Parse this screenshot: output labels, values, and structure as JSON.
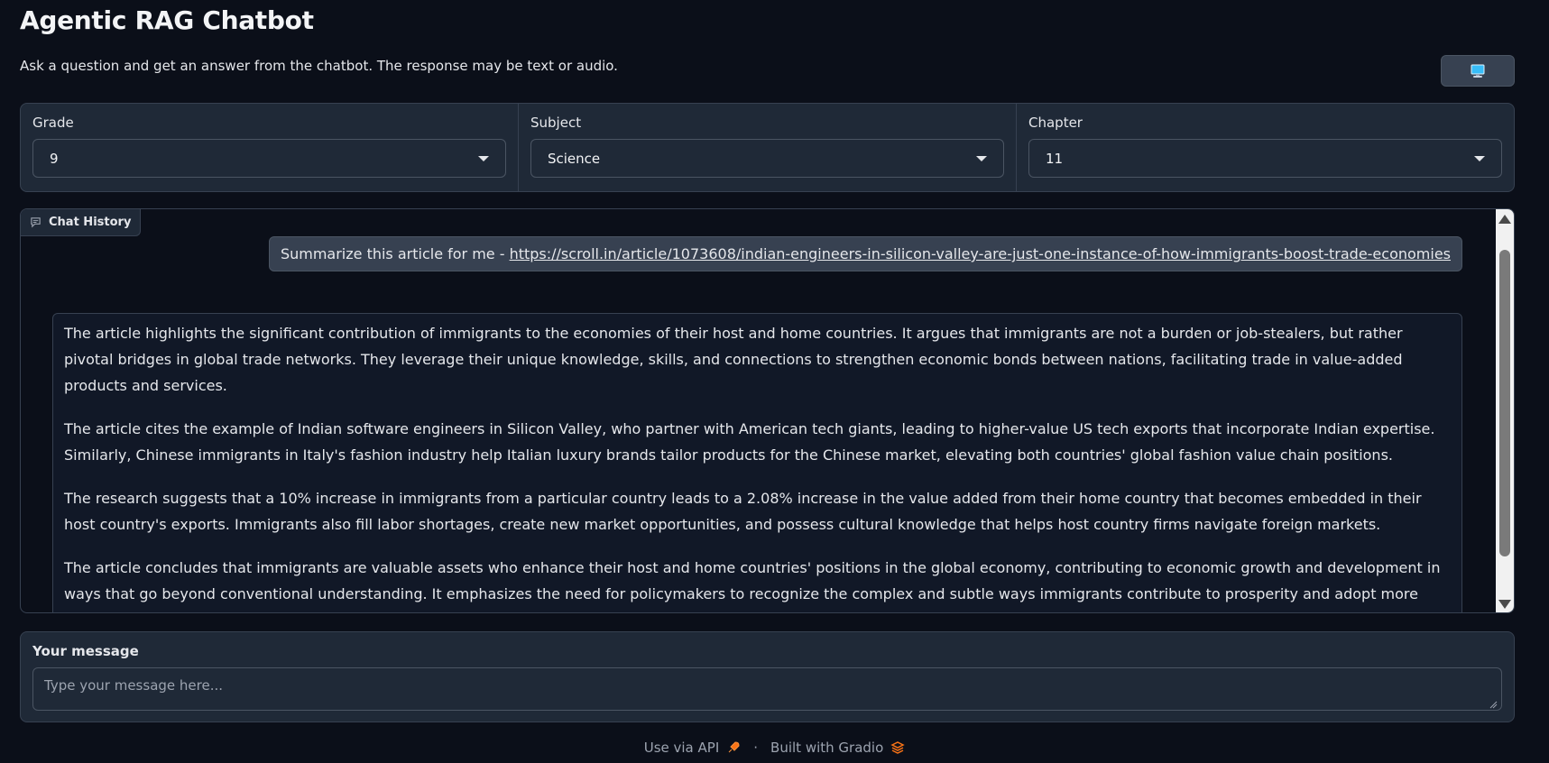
{
  "app": {
    "title": "Agentic RAG Chatbot",
    "subtitle": "Ask a question and get an answer from the chatbot. The response may be text or audio."
  },
  "dropdowns": [
    {
      "label": "Grade",
      "value": "9"
    },
    {
      "label": "Subject",
      "value": "Science"
    },
    {
      "label": "Chapter",
      "value": "11"
    }
  ],
  "chat": {
    "label": "Chat History",
    "user_message": {
      "prefix": "Summarize this article for me - ",
      "link": "https://scroll.in/article/1073608/indian-engineers-in-silicon-valley-are-just-one-instance-of-how-immigrants-boost-trade-economies"
    },
    "bot_paragraphs": [
      "The article highlights the significant contribution of immigrants to the economies of their host and home countries. It argues that immigrants are not a burden or job-stealers, but rather pivotal bridges in global trade networks. They leverage their unique knowledge, skills, and connections to strengthen economic bonds between nations, facilitating trade in value-added products and services.",
      "The article cites the example of Indian software engineers in Silicon Valley, who partner with American tech giants, leading to higher-value US tech exports that incorporate Indian expertise. Similarly, Chinese immigrants in Italy's fashion industry help Italian luxury brands tailor products for the Chinese market, elevating both countries' global fashion value chain positions.",
      "The research suggests that a 10% increase in immigrants from a particular country leads to a 2.08% increase in the value added from their home country that becomes embedded in their host country's exports. Immigrants also fill labor shortages, create new market opportunities, and possess cultural knowledge that helps host country firms navigate foreign markets.",
      "The article concludes that immigrants are valuable assets who enhance their host and home countries' positions in the global economy, contributing to economic growth and development in ways that go beyond conventional understanding. It emphasizes the need for policymakers to recognize the complex and subtle ways immigrants contribute to prosperity and adopt more open immigration policies to leverage their economic benefits."
    ]
  },
  "input": {
    "label": "Your message",
    "placeholder": "Type your message here...",
    "value": ""
  },
  "footer": {
    "api": "Use via API",
    "separator": "·",
    "built": "Built with Gradio"
  },
  "colors": {
    "background": "#0b0f19",
    "panel": "#1f2937",
    "border": "#374151",
    "accent_icon": "#f97316"
  }
}
